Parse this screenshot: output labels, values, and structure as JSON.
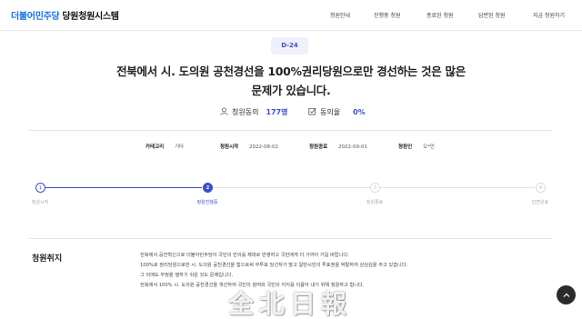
{
  "header": {
    "logo_party": "더불어민주당",
    "logo_system": "당원청원시스템",
    "nav": [
      "청원안내",
      "진행중 청원",
      "종료된 청원",
      "답변된 청원",
      "지금 청원하기"
    ]
  },
  "petition": {
    "dday": "D-24",
    "title_line1": "전북에서 시. 도의원 공천경선을 100%권리당원으로만 경선하는 것은 많은",
    "title_line2": "문제가 있습니다.",
    "agree_label": "청원동의",
    "agree_value": "177명",
    "rate_label": "동의율",
    "rate_value": "0%",
    "meta": {
      "category_label": "카테고리",
      "category_value": "기타",
      "start_label": "청원시작",
      "start_value": "2022-08-02",
      "end_label": "청원종료",
      "end_value": "2022-09-01",
      "author_label": "청원인",
      "author_value": "오*민"
    }
  },
  "steps": [
    {
      "num": "1",
      "label": "청원시작"
    },
    {
      "num": "2",
      "label": "청원진행중"
    },
    {
      "num": "3",
      "label": "청원종료"
    },
    {
      "num": "4",
      "label": "답변완료"
    }
  ],
  "content": {
    "section_title": "청원취지",
    "lines": [
      "전북에서 공천혁신으로 더불어민주당이 국민의 민의를 제대로 반영하고 국민에게 더 가까이 가길 바랍니다.",
      "100%로 권리당원으로만 시. 도의원 공천경선을 함으로써 무투표 당선자가 많고 일반시민의 투표권을 박탈하여 삼심김을 주고 있습니다.",
      "그 외에도 부정을 행하기 쉬운 것도 문제입니다.",
      "전북에서 100% 시. 도의원 공천경선을 개선하여 국민의 참여와 국민의 지지를 이끌어 내기 위해 청원하고 합니다."
    ]
  },
  "top_button_glyph": "⌃",
  "watermark": "全北日報",
  "colors": {
    "accent": "#3a4fc9",
    "party_blue": "#1a73e8"
  }
}
